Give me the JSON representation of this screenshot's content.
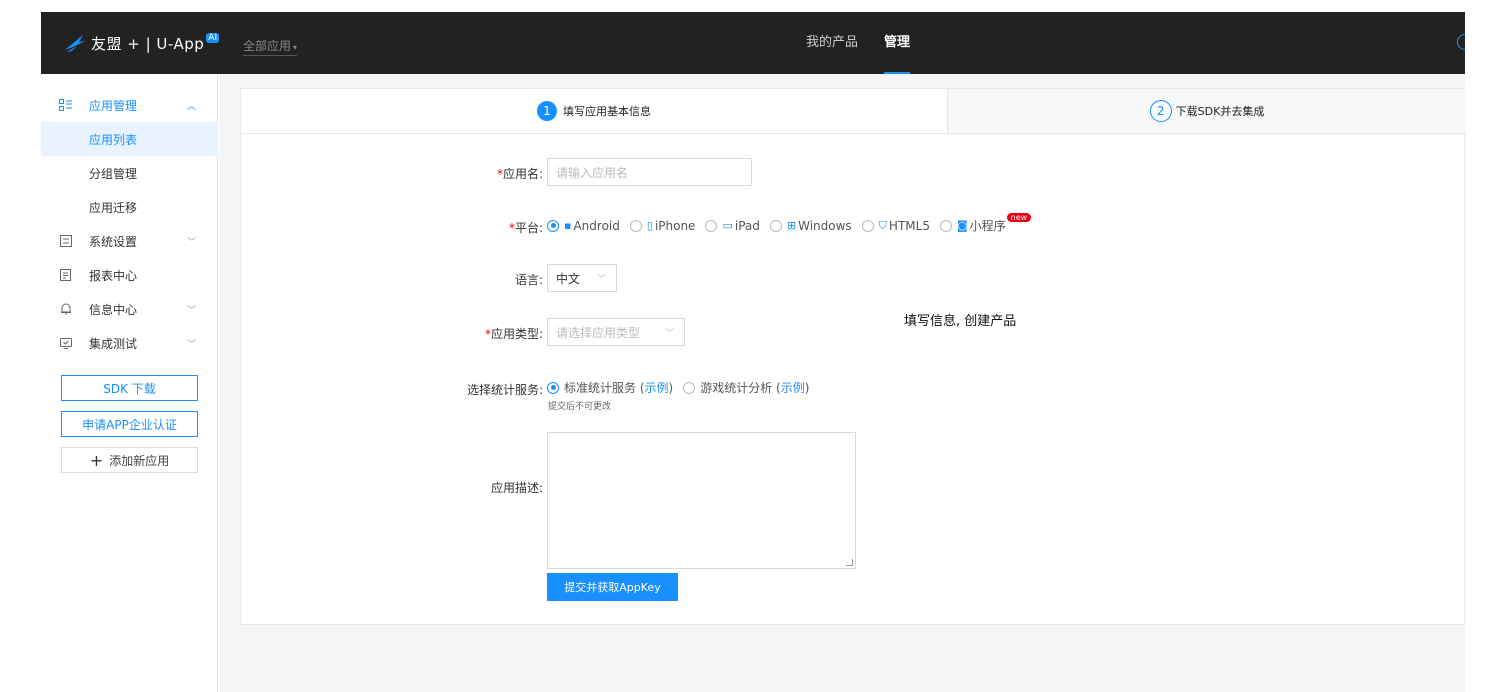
{
  "header": {
    "logo_text": "友盟 + | U-App",
    "logo_badge": "AI",
    "app_selector": "全部应用",
    "nav": [
      {
        "label": "我的产品",
        "active": false
      },
      {
        "label": "管理",
        "active": true
      }
    ]
  },
  "sidebar": {
    "groups": [
      {
        "label": "应用管理",
        "icon": "list-grid-icon",
        "expanded": true
      },
      {
        "label": "系统设置",
        "icon": "settings-panel-icon",
        "expanded": false
      },
      {
        "label": "报表中心",
        "icon": "report-icon",
        "expanded": false
      },
      {
        "label": "信息中心",
        "icon": "bell-icon",
        "expanded": false
      },
      {
        "label": "集成测试",
        "icon": "monitor-icon",
        "expanded": false
      }
    ],
    "sub_items": [
      {
        "label": "应用列表",
        "active": true
      },
      {
        "label": "分组管理",
        "active": false
      },
      {
        "label": "应用迁移",
        "active": false
      }
    ],
    "buttons": {
      "sdk_download": "SDK 下载",
      "enterprise_cert": "申请APP企业认证",
      "add_app": "添加新应用"
    }
  },
  "steps": [
    {
      "num": "1",
      "label": "填写应用基本信息",
      "active": true
    },
    {
      "num": "2",
      "label": "下载SDK并去集成",
      "active": false
    }
  ],
  "form": {
    "app_name": {
      "label": "应用名:",
      "placeholder": "请输入应用名",
      "required": "*"
    },
    "platform": {
      "label": "平台:",
      "required": "*",
      "options": [
        {
          "label": "Android",
          "icon": "android-icon",
          "selected": true
        },
        {
          "label": "iPhone",
          "icon": "iphone-icon",
          "selected": false
        },
        {
          "label": "iPad",
          "icon": "ipad-icon",
          "selected": false
        },
        {
          "label": "Windows",
          "icon": "windows-icon",
          "selected": false
        },
        {
          "label": "HTML5",
          "icon": "html5-icon",
          "selected": false
        },
        {
          "label": "小程序",
          "icon": "miniprogram-icon",
          "selected": false,
          "badge": "new"
        }
      ]
    },
    "language": {
      "label": "语言:",
      "value": "中文"
    },
    "app_type": {
      "label": "应用类型:",
      "required": "*",
      "placeholder": "请选择应用类型"
    },
    "stats_service": {
      "label": "选择统计服务:",
      "options": [
        {
          "label": "标准统计服务",
          "example": "示例",
          "selected": true
        },
        {
          "label": "游戏统计分析",
          "example": "示例",
          "selected": false
        }
      ],
      "hint": "提交后不可更改"
    },
    "description": {
      "label": "应用描述:"
    },
    "submit_label": "提交并获取AppKey"
  },
  "overlay_note": "填写信息, 创建产品",
  "colors": {
    "accent": "#1890ff",
    "topbar": "#222222",
    "required": "#e60012"
  }
}
